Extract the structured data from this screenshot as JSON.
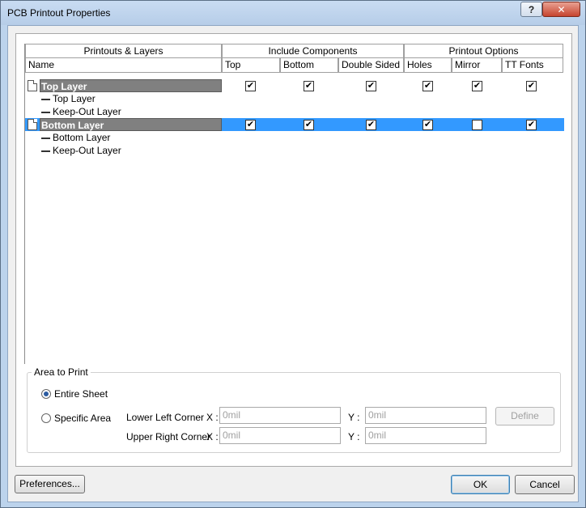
{
  "window": {
    "title": "PCB Printout Properties",
    "help_label": "?",
    "close_label": "✕"
  },
  "grid": {
    "group_headers": [
      "Printouts & Layers",
      "Include Components",
      "Printout Options"
    ],
    "columns": [
      "Name",
      "Top",
      "Bottom",
      "Double Sided",
      "Holes",
      "Mirror",
      "TT Fonts"
    ],
    "printouts": [
      {
        "name": "Top Layer",
        "checks": [
          true,
          true,
          true,
          true,
          true,
          true
        ],
        "selected": false,
        "layers": [
          "Top Layer",
          "Keep-Out Layer"
        ]
      },
      {
        "name": "Bottom Layer",
        "checks": [
          true,
          true,
          true,
          true,
          false,
          true
        ],
        "selected": true,
        "layers": [
          "Bottom Layer",
          "Keep-Out Layer"
        ]
      }
    ]
  },
  "area": {
    "group_label": "Area to Print",
    "entire_sheet": "Entire Sheet",
    "specific_area": "Specific Area",
    "selected": "entire_sheet",
    "lower_left": "Lower Left Corner",
    "upper_right": "Upper Right Corner",
    "x_label": "X :",
    "y_label": "Y :",
    "ll_x": "0mil",
    "ll_y": "0mil",
    "ur_x": "0mil",
    "ur_y": "0mil",
    "define_label": "Define"
  },
  "buttons": {
    "preferences": "Preferences...",
    "ok": "OK",
    "cancel": "Cancel"
  }
}
